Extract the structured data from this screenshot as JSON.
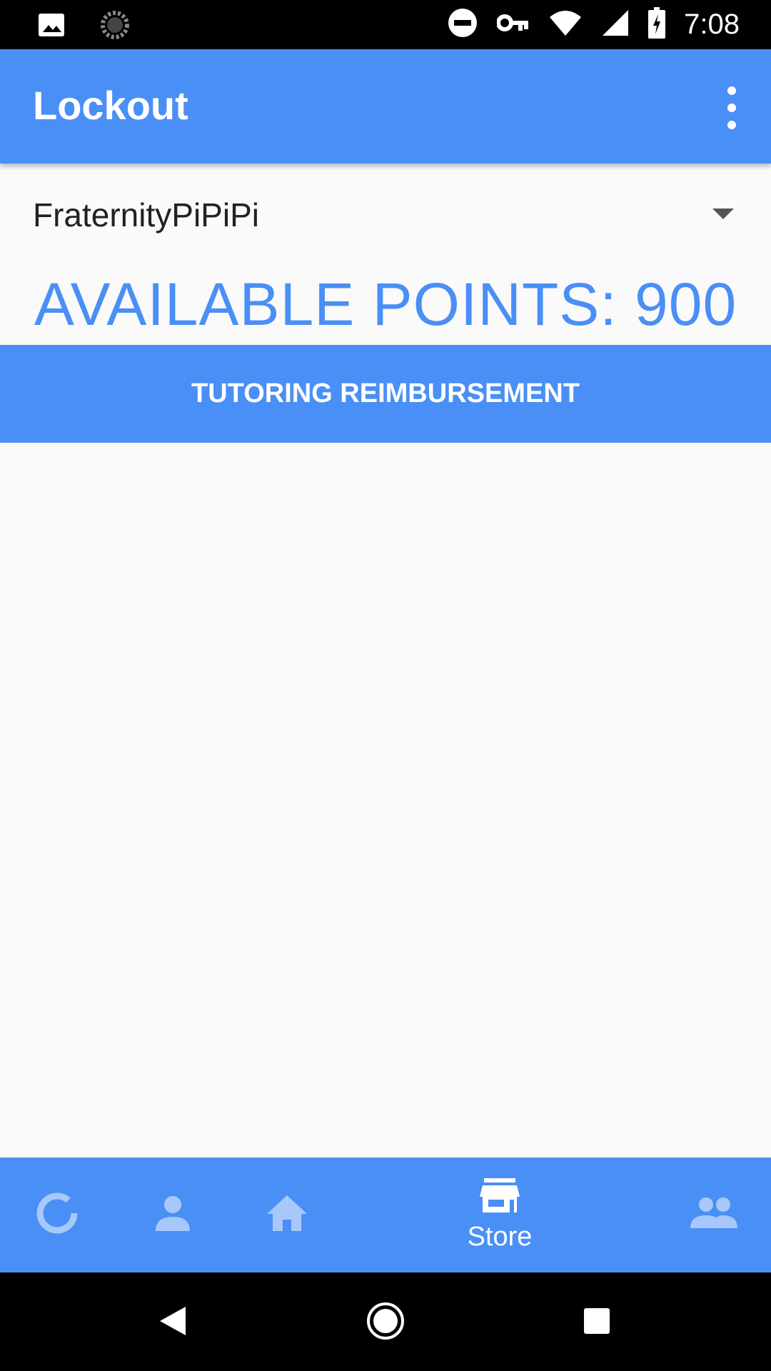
{
  "status_bar": {
    "time": "7:08",
    "icons": [
      "image-icon",
      "sync-icon",
      "do-not-disturb-icon",
      "vpn-key-icon",
      "wifi-icon",
      "cell-signal-icon",
      "battery-charging-icon"
    ]
  },
  "app_bar": {
    "title": "Lockout",
    "menu_icon": "more-vert-icon"
  },
  "group_selector": {
    "selected": "FraternityPiPiPi"
  },
  "points": {
    "text": "AVAILABLE POINTS: 900",
    "value": 900
  },
  "rewards": [
    {
      "label": "TUTORING REIMBURSEMENT"
    }
  ],
  "bottom_nav": {
    "active": "store",
    "items": [
      {
        "icon": "progress-ring-icon",
        "label": ""
      },
      {
        "icon": "person-icon",
        "label": ""
      },
      {
        "icon": "home-icon",
        "label": ""
      },
      {
        "icon": "store-icon",
        "label": "Store"
      },
      {
        "icon": "group-icon",
        "label": ""
      }
    ]
  },
  "system_nav": {
    "buttons": [
      "back-icon",
      "home-circle-icon",
      "recents-icon"
    ]
  },
  "colors": {
    "primary": "#4a8ff5",
    "inactive_nav_icon": "#a8c8fb",
    "background": "#fafafa",
    "status_bar": "#000000"
  }
}
